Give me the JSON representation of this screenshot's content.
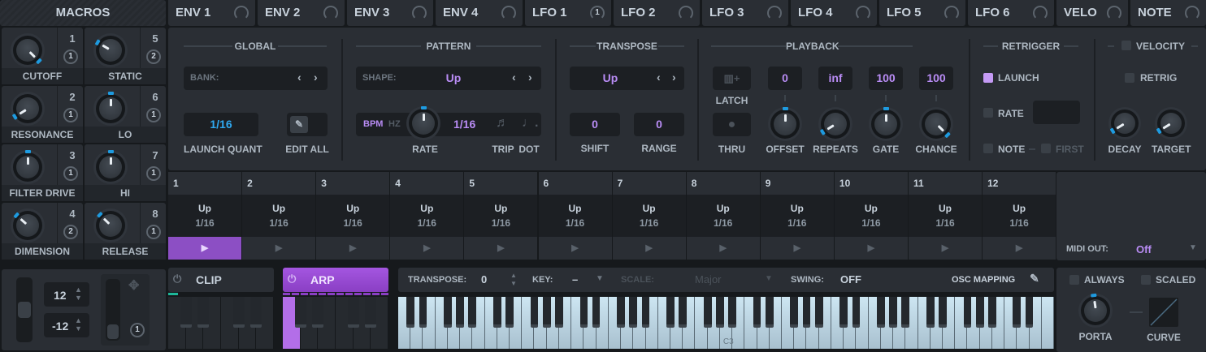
{
  "macros": {
    "title": "MACROS",
    "items": [
      {
        "label": "CUTOFF",
        "number": "1",
        "mod_count": "1",
        "value": 1.0
      },
      {
        "label": "STATIC",
        "number": "5",
        "mod_count": "2",
        "value": 0.28
      },
      {
        "label": "RESONANCE",
        "number": "2",
        "mod_count": "1",
        "value": 0.05
      },
      {
        "label": "LO",
        "number": "6",
        "mod_count": "1",
        "value": 0.5
      },
      {
        "label": "FILTER DRIVE",
        "number": "3",
        "mod_count": "1",
        "value": 0.5
      },
      {
        "label": "HI",
        "number": "7",
        "mod_count": "1",
        "value": 0.5
      },
      {
        "label": "DIMENSION",
        "number": "4",
        "mod_count": "2",
        "value": 0.32
      },
      {
        "label": "RELEASE",
        "number": "8",
        "mod_count": "1",
        "value": 0.33
      }
    ]
  },
  "mod_tabs": [
    {
      "label": "ENV 1",
      "badge": ""
    },
    {
      "label": "ENV 2",
      "badge": ""
    },
    {
      "label": "ENV 3",
      "badge": ""
    },
    {
      "label": "ENV 4",
      "badge": ""
    },
    {
      "label": "LFO 1",
      "badge": "1"
    },
    {
      "label": "LFO 2",
      "badge": ""
    },
    {
      "label": "LFO 3",
      "badge": ""
    },
    {
      "label": "LFO 4",
      "badge": ""
    },
    {
      "label": "LFO 5",
      "badge": ""
    },
    {
      "label": "LFO 6",
      "badge": ""
    },
    {
      "label": "VELO",
      "badge": ""
    },
    {
      "label": "NOTE",
      "badge": ""
    }
  ],
  "global": {
    "title": "GLOBAL",
    "bank_label": "BANK:",
    "launch_quant": "1/16",
    "launch_quant_label": "LAUNCH QUANT",
    "edit_all_label": "EDIT ALL"
  },
  "pattern": {
    "title": "PATTERN",
    "shape_label": "SHAPE:",
    "shape_value": "Up",
    "bpm": "BPM",
    "hz": "HZ",
    "rate_value": "1/16",
    "rate_label": "RATE",
    "rate_knob": 0.5,
    "trip_label": "TRIP",
    "dot_label": "DOT"
  },
  "transpose": {
    "title": "TRANSPOSE",
    "value": "Up",
    "shift": "0",
    "shift_label": "SHIFT",
    "range": "0",
    "range_label": "RANGE"
  },
  "playback": {
    "title": "PLAYBACK",
    "latch_label": "LATCH",
    "thru_label": "THRU",
    "knobs": [
      {
        "label": "OFFSET",
        "value_text": "0",
        "value": 0.5
      },
      {
        "label": "REPEATS",
        "value_text": "inf",
        "value": 0.05
      },
      {
        "label": "GATE",
        "value_text": "100",
        "value": 0.5
      },
      {
        "label": "CHANCE",
        "value_text": "100",
        "value": 1.0
      }
    ]
  },
  "retrigger": {
    "title": "RETRIGGER",
    "launch": "LAUNCH",
    "rate": "RATE",
    "note": "NOTE",
    "first": "FIRST"
  },
  "velocity": {
    "title": "VELOCITY",
    "retrig": "RETRIG",
    "decay_label": "DECAY",
    "decay": 0.05,
    "target_label": "TARGET",
    "target": 0.05
  },
  "steps": [
    {
      "n": "1",
      "shape": "Up",
      "rate": "1/16"
    },
    {
      "n": "2",
      "shape": "Up",
      "rate": "1/16"
    },
    {
      "n": "3",
      "shape": "Up",
      "rate": "1/16"
    },
    {
      "n": "4",
      "shape": "Up",
      "rate": "1/16"
    },
    {
      "n": "5",
      "shape": "Up",
      "rate": "1/16"
    },
    {
      "n": "6",
      "shape": "Up",
      "rate": "1/16"
    },
    {
      "n": "7",
      "shape": "Up",
      "rate": "1/16"
    },
    {
      "n": "8",
      "shape": "Up",
      "rate": "1/16"
    },
    {
      "n": "9",
      "shape": "Up",
      "rate": "1/16"
    },
    {
      "n": "10",
      "shape": "Up",
      "rate": "1/16"
    },
    {
      "n": "11",
      "shape": "Up",
      "rate": "1/16"
    },
    {
      "n": "12",
      "shape": "Up",
      "rate": "1/16"
    }
  ],
  "midi_out": {
    "label": "MIDI OUT:",
    "value": "Off"
  },
  "bottom": {
    "range_hi": "12",
    "range_lo": "-12",
    "mod_badge": "1",
    "clip_label": "CLIP",
    "arp_label": "ARP",
    "transpose_label": "TRANSPOSE:",
    "transpose_value": "0",
    "key_label": "KEY:",
    "key_value": "–",
    "scale_label": "SCALE:",
    "scale_value": "Major",
    "swing_label": "SWING:",
    "swing_value": "OFF",
    "osc_mapping": "OSC MAPPING",
    "c3": "C3",
    "always": "ALWAYS",
    "scaled": "SCALED",
    "porta_label": "PORTA",
    "porta": 0.47,
    "curve_label": "CURVE"
  },
  "colors": {
    "accent": "#b98cf5",
    "knob_tip": "#1e9be0",
    "arp": "#9b4fd6"
  }
}
